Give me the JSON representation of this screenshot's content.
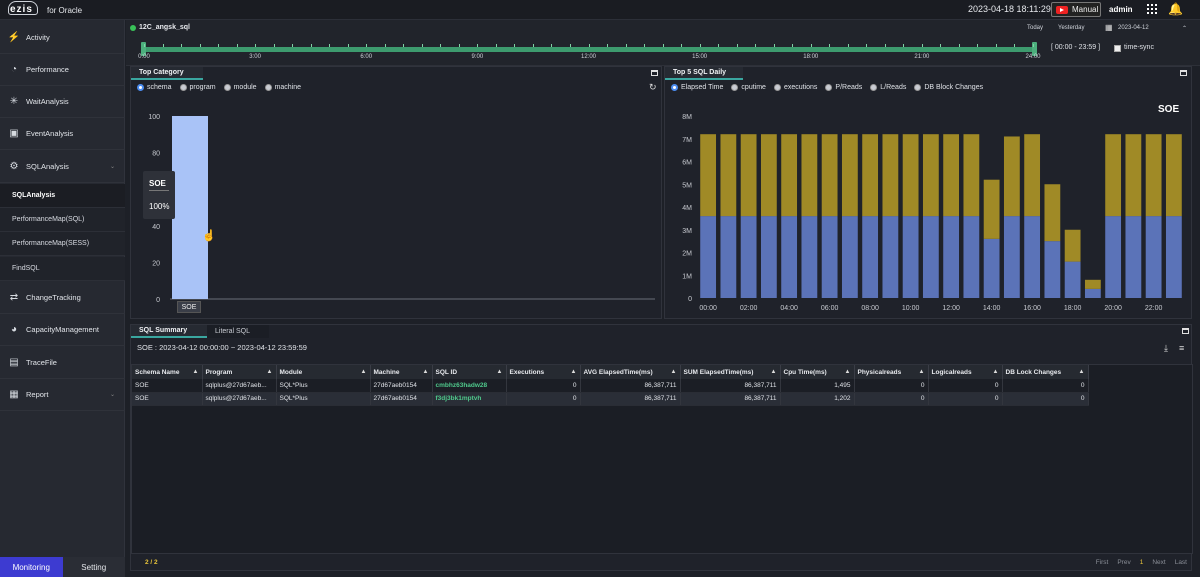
{
  "topbar": {
    "logo": "ezis",
    "product": "for Oracle",
    "datetime": "2023-04-18 18:11:29",
    "manual": "Manual",
    "user": "admin"
  },
  "sidebar": {
    "items": [
      {
        "label": "Activity",
        "icon": "activity-icon"
      },
      {
        "label": "Performance",
        "icon": "gauge-icon"
      },
      {
        "label": "WaitAnalysis",
        "icon": "spinner-icon"
      },
      {
        "label": "EventAnalysis",
        "icon": "event-icon"
      },
      {
        "label": "SQLAnalysis",
        "icon": "sql-icon"
      },
      {
        "label": "ChangeTracking",
        "icon": "sync-icon"
      },
      {
        "label": "CapacityManagement",
        "icon": "pie-icon"
      },
      {
        "label": "TraceFile",
        "icon": "file-icon"
      },
      {
        "label": "Report",
        "icon": "report-icon"
      }
    ],
    "sub_items": [
      "SQLAnalysis",
      "PerformanceMap(SQL)",
      "PerformanceMap(SESS)",
      "FindSQL"
    ],
    "bottom_tabs": [
      "Monitoring",
      "Setting"
    ]
  },
  "dbbar": {
    "name": "12C_angsk_sql",
    "today": "Today",
    "yesterday": "Yesterday",
    "date": "2023-04-12"
  },
  "timeline": {
    "labels": [
      "0:00",
      "3:00",
      "6:00",
      "9:00",
      "12:00",
      "15:00",
      "18:00",
      "21:00",
      "24:00"
    ],
    "range": "[ 00:00 - 23:59 ]",
    "timesync": "time-sync"
  },
  "top_category": {
    "tab": "Top Category",
    "options": [
      "schema",
      "program",
      "module",
      "machine"
    ],
    "selected": "schema",
    "yticks": [
      "100",
      "80",
      "60",
      "40",
      "20",
      "0"
    ],
    "tooltip": {
      "name": "SOE",
      "value": "100%"
    },
    "category": "SOE"
  },
  "top5": {
    "tab": "Top 5 SQL Daily",
    "options": [
      "Elapsed Time",
      "cputime",
      "executions",
      "P/Reads",
      "L/Reads",
      "DB Block Changes"
    ],
    "selected": "Elapsed Time",
    "title": "SOE",
    "yticks": [
      "8M",
      "7M",
      "6M",
      "5M",
      "4M",
      "3M",
      "2M",
      "1M",
      "0"
    ],
    "xticks": [
      "00:00",
      "02:00",
      "04:00",
      "06:00",
      "08:00",
      "10:00",
      "12:00",
      "14:00",
      "16:00",
      "18:00",
      "20:00",
      "22:00"
    ]
  },
  "chart_data": [
    {
      "type": "bar",
      "title": "",
      "categories": [
        "SOE"
      ],
      "values": [
        100
      ],
      "ylim": [
        0,
        100
      ],
      "xlabel": "",
      "ylabel": ""
    },
    {
      "type": "bar",
      "title": "SOE",
      "stacked": true,
      "ylim": [
        0,
        8000000
      ],
      "x": [
        "00",
        "01",
        "02",
        "03",
        "04",
        "05",
        "06",
        "07",
        "08",
        "09",
        "10",
        "11",
        "12",
        "13",
        "14",
        "15",
        "16",
        "17",
        "18",
        "19",
        "20",
        "21",
        "22",
        "23"
      ],
      "series": [
        {
          "values": [
            3600000,
            3600000,
            3600000,
            3600000,
            3600000,
            3600000,
            3600000,
            3600000,
            3600000,
            3600000,
            3600000,
            3600000,
            3600000,
            3600000,
            2600000,
            3600000,
            3600000,
            2500000,
            1600000,
            400000,
            3600000,
            3600000,
            3600000,
            3600000
          ],
          "color": "#5b73b8"
        },
        {
          "values": [
            3600000,
            3600000,
            3600000,
            3600000,
            3600000,
            3600000,
            3600000,
            3600000,
            3600000,
            3600000,
            3600000,
            3600000,
            3600000,
            3600000,
            2600000,
            3500000,
            3600000,
            2500000,
            1400000,
            400000,
            3600000,
            3600000,
            3600000,
            3600000
          ],
          "color": "#a08a26"
        }
      ]
    }
  ],
  "summary": {
    "tabs": [
      "SQL Summary",
      "Literal SQL"
    ],
    "header": "SOE : 2023-04-12 00:00:00 ~ 2023-04-12 23:59:59",
    "columns": [
      "Schema Name",
      "Program",
      "Module",
      "Machine",
      "SQL ID",
      "Executions",
      "AVG ElapsedTime(ms)",
      "SUM ElapsedTime(ms)",
      "Cpu Time(ms)",
      "Physicalreads",
      "Logicalreads",
      "DB Lock Changes"
    ],
    "rows": [
      [
        "SOE",
        "sqlplus@27d67aeb...",
        "SQL*Plus",
        "27d67aeb0154",
        "cmbhz63hadw28",
        "0",
        "86,387,711",
        "86,387,711",
        "1,495",
        "0",
        "0",
        "0"
      ],
      [
        "SOE",
        "sqlplus@27d67aeb...",
        "SQL*Plus",
        "27d67aeb0154",
        "f3dj3bk1mptvh",
        "0",
        "86,387,711",
        "86,387,711",
        "1,202",
        "0",
        "0",
        "0"
      ]
    ],
    "pager": {
      "count": "2 / 2",
      "first": "First",
      "prev": "Prev",
      "page": "1",
      "next": "Next",
      "last": "Last"
    }
  }
}
